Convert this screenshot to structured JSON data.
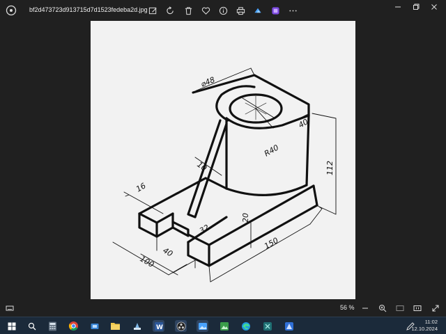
{
  "window": {
    "filename": "bf2d473723d913715d7d1523fedeba2d.jpg"
  },
  "toolbar": {
    "icons": [
      "edit-image-icon",
      "rotate-icon",
      "delete-icon",
      "favorite-icon",
      "info-icon",
      "print-icon",
      "cloud-icon",
      "clipchamp-icon",
      "more-icon"
    ]
  },
  "drawing": {
    "dimensions": {
      "dia": "⌀48",
      "d40_top": "40",
      "r40": "R40",
      "d10": "10",
      "d16": "16",
      "d112": "112",
      "d20": "20",
      "d32": "32",
      "d150": "150",
      "d40_front": "40",
      "d100": "100"
    }
  },
  "statusbar": {
    "zoom": "56 %"
  },
  "taskbar": {
    "time": "11:02",
    "date": "12.10.2024"
  }
}
